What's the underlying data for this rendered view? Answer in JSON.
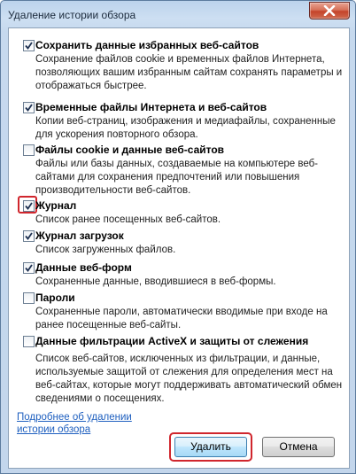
{
  "window": {
    "title": "Удаление истории обзора"
  },
  "items": [
    {
      "label": "Сохранить данные избранных веб-сайтов",
      "checked": true,
      "description": "Сохранение файлов cookie и временных файлов Интернета, позволяющих вашим избранным сайтам сохранять параметры и отображаться быстрее."
    },
    {
      "label": "Временные файлы Интернета и веб-сайтов",
      "checked": true,
      "description": "Копии веб-страниц, изображения и медиафайлы, сохраненные для ускорения повторного обзора."
    },
    {
      "label": "Файлы cookie и данные веб-сайтов",
      "checked": false,
      "description": "Файлы или базы данных, создаваемые на компьютере веб-сайтами для сохранения предпочтений или повышения производительности веб-сайтов."
    },
    {
      "label": "Журнал",
      "checked": true,
      "highlighted": true,
      "description": "Список ранее посещенных веб-сайтов."
    },
    {
      "label": "Журнал загрузок",
      "checked": true,
      "description": "Список загруженных файлов."
    },
    {
      "label": "Данные веб-форм",
      "checked": true,
      "description": "Сохраненные данные, вводившиеся в веб-формы."
    },
    {
      "label": "Пароли",
      "checked": false,
      "description": "Сохраненные пароли, автоматически вводимые при входе на ранее посещенные веб-сайты."
    },
    {
      "label": "Данные фильтрации ActiveX и защиты от слежения",
      "checked": false,
      "description": "Список веб-сайтов, исключенных из фильтрации, и данные, используемые защитой от слежения для определения мест на веб-сайтах, которые могут поддерживать автоматический обмен сведениями о посещениях."
    }
  ],
  "footer": {
    "link": "Подробнее об удалении истории обзора",
    "delete_label": "Удалить",
    "cancel_label": "Отмена"
  },
  "icons": {
    "close": "close-icon",
    "check": "checkmark-icon"
  }
}
